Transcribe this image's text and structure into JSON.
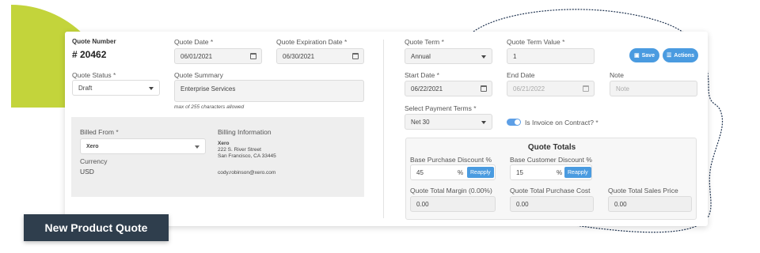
{
  "card": {
    "quote_number": {
      "label": "Quote Number",
      "value": "# 20462"
    },
    "quote_date": {
      "label": "Quote Date",
      "required": "*",
      "value": "06/01/2021",
      "icon": "calendar-icon"
    },
    "quote_expiration_date": {
      "label": "Quote Expiration Date",
      "required": "*",
      "value": "06/30/2021",
      "icon": "calendar-icon"
    },
    "quote_status": {
      "label": "Quote Status",
      "required": "*",
      "value": "Draft"
    },
    "quote_summary": {
      "label": "Quote Summary",
      "value": "Enterprise Services",
      "hint": "max of 255 characters allowed"
    },
    "billed_from": {
      "label": "Billed From",
      "required": "*",
      "value": "Xero"
    },
    "currency": {
      "label": "Currency",
      "value": "USD"
    },
    "billing_information": {
      "label": "Billing Information",
      "company": "Xero",
      "address_line1": "222 S. River Street",
      "address_line2": "San Francisco, CA 33445",
      "email": "cody.robinson@xero.com"
    },
    "quote_term": {
      "label": "Quote Term",
      "required": "*",
      "value": "Annual"
    },
    "quote_term_value": {
      "label": "Quote Term Value",
      "required": "*",
      "value": "1"
    },
    "actions": {
      "save_label": "Save",
      "actions_label": "Actions",
      "save_icon": "save-icon",
      "actions_icon": "list-icon"
    },
    "start_date": {
      "label": "Start Date",
      "required": "*",
      "value": "06/22/2021",
      "icon": "calendar-icon"
    },
    "end_date": {
      "label": "End Date",
      "value": "06/21/2022",
      "icon": "calendar-icon"
    },
    "note": {
      "label": "Note",
      "placeholder": "Note"
    },
    "payment_terms": {
      "label": "Select Payment Terms",
      "required": "*",
      "value": "Net 30"
    },
    "invoice_on_contract": {
      "label": "Is Invoice on Contract?",
      "required": "*",
      "checked": true
    },
    "totals": {
      "title": "Quote Totals",
      "base_purchase_discount": {
        "label": "Base Purchase Discount %",
        "value": "45",
        "unit": "%",
        "button": "Reapply"
      },
      "base_customer_discount": {
        "label": "Base Customer Discount %",
        "value": "15",
        "unit": "%",
        "button": "Reapply"
      },
      "total_margin": {
        "label": "Quote Total Margin (0.00%)",
        "value": "0.00"
      },
      "total_purchase_cost": {
        "label": "Quote Total Purchase Cost",
        "value": "0.00"
      },
      "total_sales_price": {
        "label": "Quote Total Sales Price",
        "value": "0.00"
      }
    }
  },
  "banner": {
    "title": "New Product Quote"
  },
  "colors": {
    "accent": "#4a9be0",
    "decor_green": "#c3d43b",
    "banner_bg": "#2f3e4d",
    "decor_line": "#1f3350"
  }
}
